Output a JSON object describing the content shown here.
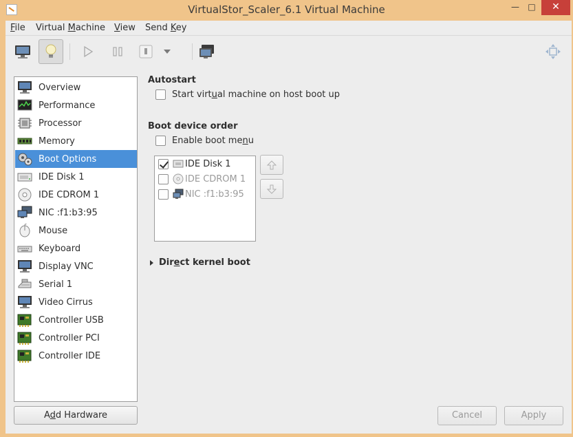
{
  "window": {
    "title": "VirtualStor_Scaler_6.1 Virtual Machine",
    "minimize_glyph": "—",
    "maximize_glyph": "□",
    "close_glyph": "✕"
  },
  "menu": {
    "items": [
      {
        "label_u": "F",
        "label_rest": "ile"
      },
      {
        "label_pre": "Virtual ",
        "label_u": "M",
        "label_rest": "achine"
      },
      {
        "label_u": "V",
        "label_rest": "iew"
      },
      {
        "label_pre": "Send ",
        "label_u": "K",
        "label_rest": "ey"
      }
    ]
  },
  "toolbar": {
    "icons": [
      "monitor-icon",
      "lightbulb-icon",
      "play-icon",
      "pause-icon",
      "power-icon",
      "dropdown-arrow-icon",
      "screenshot-icon",
      "fullscreen-icon"
    ]
  },
  "sidebar": {
    "items": [
      {
        "label": "Overview",
        "icon": "monitor-icon"
      },
      {
        "label": "Performance",
        "icon": "performance-icon"
      },
      {
        "label": "Processor",
        "icon": "processor-icon"
      },
      {
        "label": "Memory",
        "icon": "memory-icon"
      },
      {
        "label": "Boot Options",
        "icon": "boot-options-icon",
        "selected": true
      },
      {
        "label": "IDE Disk 1",
        "icon": "disk-icon"
      },
      {
        "label": "IDE CDROM 1",
        "icon": "cdrom-icon"
      },
      {
        "label": "NIC :f1:b3:95",
        "icon": "network-icon"
      },
      {
        "label": "Mouse",
        "icon": "mouse-icon"
      },
      {
        "label": "Keyboard",
        "icon": "keyboard-icon"
      },
      {
        "label": "Display VNC",
        "icon": "display-icon"
      },
      {
        "label": "Serial 1",
        "icon": "serial-icon"
      },
      {
        "label": "Video Cirrus",
        "icon": "video-icon"
      },
      {
        "label": "Controller USB",
        "icon": "controller-icon"
      },
      {
        "label": "Controller PCI",
        "icon": "controller-icon"
      },
      {
        "label": "Controller IDE",
        "icon": "controller-icon"
      }
    ],
    "add_hardware": {
      "pre": "A",
      "u": "d",
      "rest": "d Hardware"
    }
  },
  "autostart": {
    "title": "Autostart",
    "checkbox": {
      "pre": "Start virt",
      "u": "u",
      "rest": "al machine on host boot up",
      "checked": false
    }
  },
  "boot_order": {
    "title": "Boot device order",
    "enable_menu": {
      "pre": "Enable boot me",
      "u": "n",
      "rest": "u",
      "checked": false
    },
    "devices": [
      {
        "label": "IDE Disk 1",
        "checked": true,
        "enabled": true,
        "icon": "disk-icon"
      },
      {
        "label": "IDE CDROM 1",
        "checked": false,
        "enabled": false,
        "icon": "cdrom-icon"
      },
      {
        "label": "NIC :f1:b3:95",
        "checked": false,
        "enabled": false,
        "icon": "network-icon"
      }
    ],
    "move_up_icon": "arrow-up-icon",
    "move_down_icon": "arrow-down-icon"
  },
  "kernel_boot": {
    "pre": "Dir",
    "u": "e",
    "rest": "ct kernel boot",
    "expanded": false
  },
  "footer": {
    "cancel_label": "Cancel",
    "apply_label": "Apply"
  },
  "colors": {
    "selection": "#4a90d9",
    "window_frame": "#f0c48a",
    "close_button": "#c7403a"
  }
}
